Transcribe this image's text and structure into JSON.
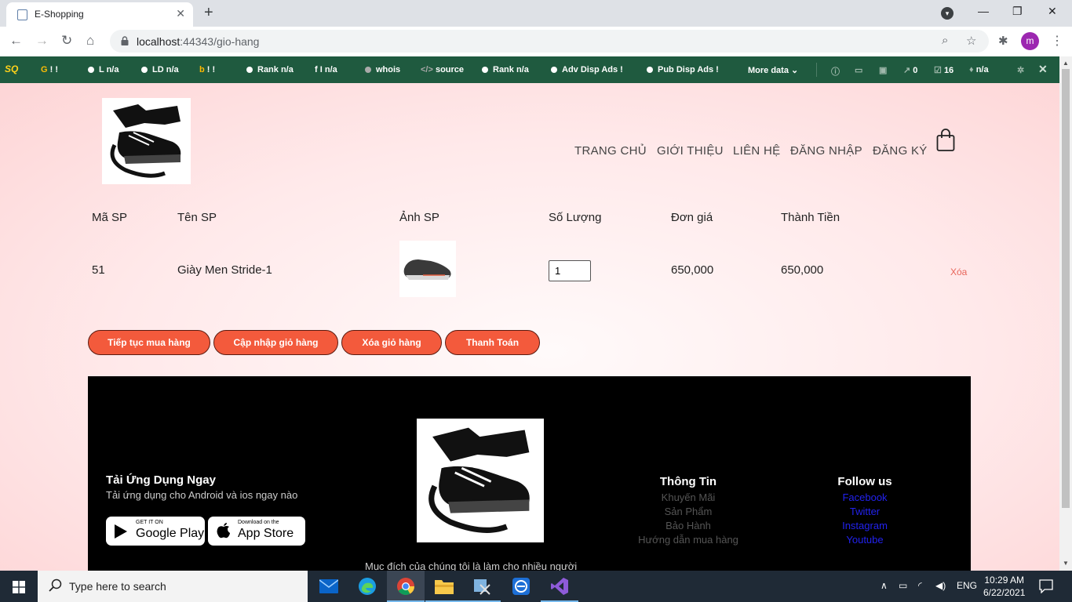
{
  "browser": {
    "tab_title": "E-Shopping",
    "url_host": "localhost",
    "url_rest": ":44343/gio-hang",
    "avatar_letter": "m"
  },
  "seobar": {
    "logo": "SQ",
    "items": [
      {
        "icon": "G",
        "label": "!  !"
      },
      {
        "icon": "●",
        "label": "L n/a"
      },
      {
        "icon": "●",
        "label": "LD n/a"
      },
      {
        "icon": "b",
        "label": "!  !"
      },
      {
        "icon": "●",
        "label": "Rank n/a"
      },
      {
        "icon": "f",
        "label": "I n/a"
      },
      {
        "icon": "●",
        "label": "whois"
      },
      {
        "icon": "</>",
        "label": "source"
      },
      {
        "icon": "●",
        "label": "Rank n/a"
      },
      {
        "icon": "●",
        "label": "Adv Disp Ads  !"
      },
      {
        "icon": "●",
        "label": "Pub Disp Ads  !"
      },
      {
        "icon": "",
        "label": "More data ⌄"
      },
      {
        "icon": "",
        "label": "0"
      },
      {
        "icon": "",
        "label": "16"
      },
      {
        "icon": "",
        "label": "n/a"
      }
    ]
  },
  "nav": {
    "home": "TRANG CHỦ",
    "about": "GIỚI THIỆU",
    "contact": "LIÊN HỆ",
    "login": "ĐĂNG NHẬP",
    "register": "ĐĂNG KÝ"
  },
  "cart_table": {
    "headers": {
      "id": "Mã SP",
      "name": "Tên SP",
      "image": "Ảnh SP",
      "qty": "Số Lượng",
      "price": "Đơn giá",
      "total": "Thành Tiền"
    },
    "rows": [
      {
        "id": "51",
        "name": "Giày Men Stride-1",
        "qty": "1",
        "price": "650,000",
        "total": "650,000",
        "delete": "Xóa"
      }
    ]
  },
  "actions": {
    "continue": "Tiếp tục mua hàng",
    "update": "Cập nhập giỏ hàng",
    "clear": "Xóa giỏ hàng",
    "checkout": "Thanh Toán"
  },
  "footer": {
    "app_title": "Tải Ứng Dụng Ngay",
    "app_sub": "Tải ứng dụng cho Android và ios ngay nào",
    "google_small": "GET IT ON",
    "google_big": "Google Play",
    "apple_small": "Download on the",
    "apple_big": "App Store",
    "tagline": "Mục đích của chúng tôi là làm cho nhiều người",
    "info_title": "Thông Tin",
    "info_links": [
      "Khuyến Mãi",
      "Sản Phẩm",
      "Bảo Hành",
      "Hướng dẫn mua hàng"
    ],
    "follow_title": "Follow us",
    "follow_links": [
      "Facebook",
      "Twitter",
      "Instagram",
      "Youtube"
    ]
  },
  "taskbar": {
    "search_placeholder": "Type here to search",
    "lang": "ENG",
    "time": "10:29 AM",
    "date": "6/22/2021"
  },
  "colors": {
    "button": "#f35a3c",
    "seobar": "#1f5a3f",
    "follow_link": "#2222ee"
  }
}
